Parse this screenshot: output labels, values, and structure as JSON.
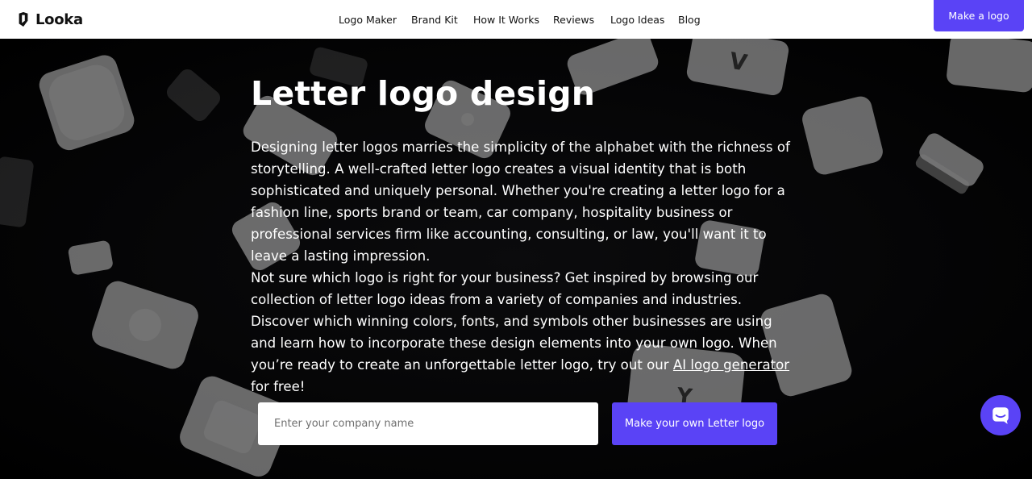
{
  "header": {
    "brand": "Looka",
    "nav": [
      {
        "label": "Logo Maker"
      },
      {
        "label": "Brand Kit"
      },
      {
        "label": "How It Works"
      },
      {
        "label": "Reviews"
      },
      {
        "label": "Logo Ideas"
      },
      {
        "label": "Blog"
      }
    ],
    "cta_label": "Make a logo"
  },
  "hero": {
    "title": "Letter logo design",
    "paragraph1": "Designing letter logos marries the simplicity of the alphabet with the richness of storytelling. A well-crafted letter logo creates a visual identity that is both sophisticated and uniquely personal. Whether you're creating a letter logo for a fashion line, sports brand or team, car company, hospitality business or professional services firm like accounting, consulting, or law, you'll want it to leave a lasting impression.",
    "paragraph2_before_link": "Not sure which logo is right for your business? Get inspired by browsing our collection of letter logo ideas from a variety of companies and industries. Discover which winning colors, fonts, and symbols other businesses are using and learn how to incorporate these design elements into your own logo. When you’re ready to create an unforgettable letter logo, try out our ",
    "paragraph2_link": "AI logo generator",
    "paragraph2_after_link": " for free!",
    "input_placeholder": "Enter your company name",
    "input_value": "",
    "button_label": "Make your own Letter logo"
  },
  "colors": {
    "accent": "#5a43f6",
    "background": "#000000",
    "header_bg": "#ffffff"
  },
  "icons": {
    "brand": "looka-logo-icon",
    "chat": "chat-bubble-icon"
  }
}
